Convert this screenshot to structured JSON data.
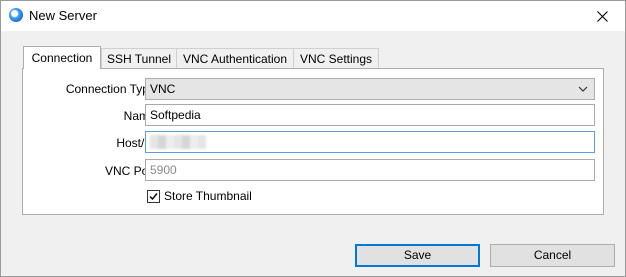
{
  "window": {
    "title": "New Server"
  },
  "tabs": [
    {
      "label": "Connection"
    },
    {
      "label": "SSH Tunnel"
    },
    {
      "label": "VNC Authentication"
    },
    {
      "label": "VNC Settings"
    }
  ],
  "form": {
    "connection_type_label": "Connection Type:",
    "connection_type_value": "VNC",
    "name_label": "Name:",
    "name_value": "Softpedia",
    "host_label": "Host/IP:",
    "vnc_port_label": "VNC Port:",
    "vnc_port_placeholder": "5900",
    "store_thumbnail_label": "Store Thumbnail",
    "store_thumbnail_checked": true
  },
  "buttons": {
    "save": "Save",
    "cancel": "Cancel"
  },
  "icons": {
    "app": "app-logo-icon",
    "close": "close-icon",
    "dropdown": "chevron-down-icon",
    "check": "checkmark-icon"
  },
  "colors": {
    "focus_border": "#5e9ed6",
    "default_button_border": "#0078d7",
    "panel_bg": "#ffffff",
    "window_bg": "#f0f0f0"
  }
}
